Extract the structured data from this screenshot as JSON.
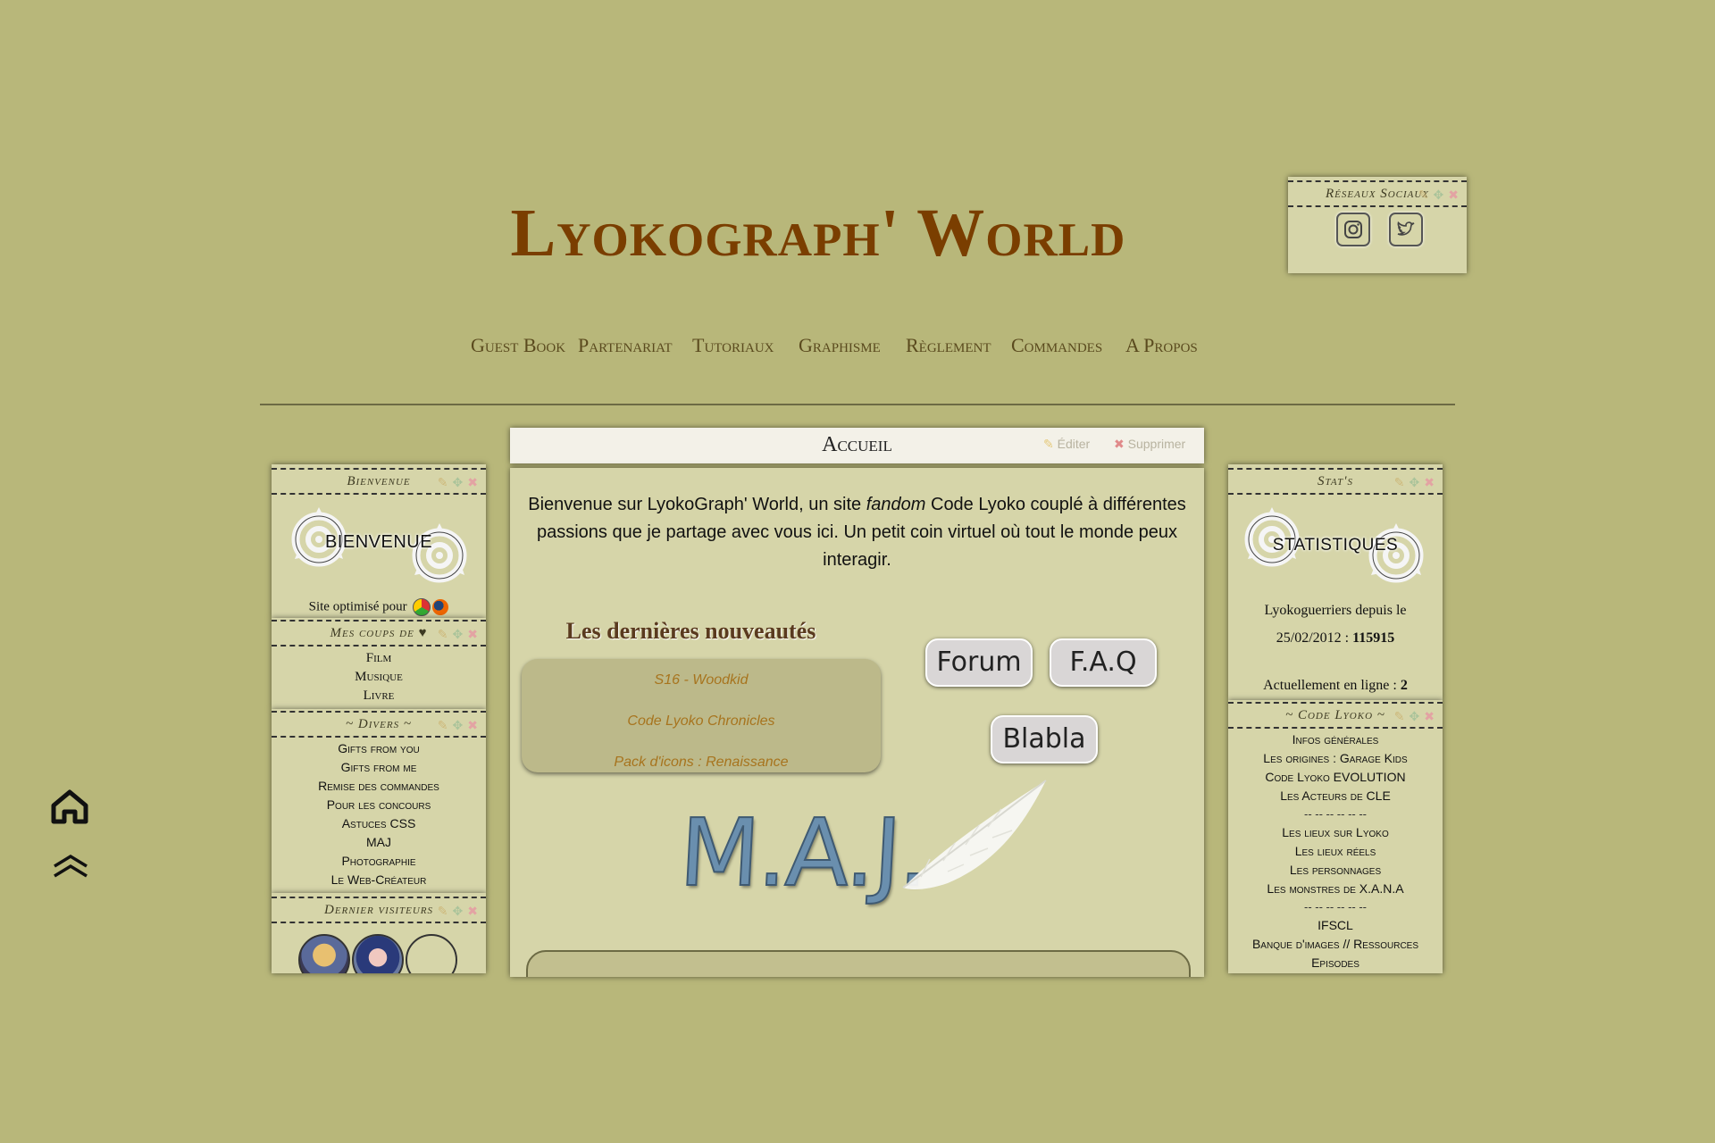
{
  "site": {
    "title": "Lyokograph' World"
  },
  "nav": [
    {
      "label": "Guest Book"
    },
    {
      "label": "Partenariat"
    },
    {
      "label": "Tutoriaux"
    },
    {
      "label": "Graphisme"
    },
    {
      "label": "Règlement"
    },
    {
      "label": "Commandes"
    },
    {
      "label": "A Propos"
    }
  ],
  "social": {
    "title": "Réseaux Sociaux",
    "icons": [
      "instagram-icon",
      "twitter-icon"
    ]
  },
  "left": {
    "bienvenue": {
      "title": "Bienvenue",
      "emblem_text": "BIENVENUE",
      "optimized_text": "Site optimisé pour"
    },
    "coups": {
      "title": "Mes coups de ♥",
      "items": [
        "Film",
        "Musique",
        "Livre"
      ]
    },
    "divers": {
      "title": "~ Divers ~",
      "items": [
        "Gifts from you",
        "Gifts from me",
        "Remise des commandes",
        "Pour les concours",
        "Astuces CSS",
        "MAJ",
        "Photographie",
        "Le Web-Créateur"
      ]
    },
    "visiteurs": {
      "title": "Dernier visiteurs"
    }
  },
  "center": {
    "title": "Accueil",
    "edit_label": "Éditer",
    "delete_label": "Supprimer",
    "welcome_pre": "Bienvenue sur LyokoGraph' World, un site ",
    "welcome_em": "fandom",
    "welcome_post": " Code Lyoko couplé à différentes passions que je partage avec vous ici. Un petit coin virtuel où tout le monde peux interagir.",
    "news_title": "Les dernières nouveautés",
    "news": [
      "S16 - Woodkid",
      "Code Lyoko Chronicles",
      "Pack d'icons : Renaissance"
    ],
    "buttons": {
      "forum": "Forum",
      "faq": "F.A.Q",
      "blabla": "Blabla"
    },
    "maj_text": "M.A.J."
  },
  "right": {
    "stats": {
      "title": "Stat's",
      "emblem_text": "STATISTIQUES",
      "since_label": "Lyokoguerriers depuis le",
      "since_date": "25/02/2012 : ",
      "count": "115915",
      "online_label": "Actuellement en ligne : ",
      "online_count": "2"
    },
    "codelyoko": {
      "title": "~ Code Lyoko ~",
      "group1": [
        "Infos générales",
        "Les origines : Garage Kids",
        "Code Lyoko EVOLUTION",
        "Les Acteurs de CLE"
      ],
      "divider": "-- -- -- -- -- --",
      "group2": [
        "Les lieux sur Lyoko",
        "Les lieux réels",
        "Les personnages",
        "Les monstres de X.A.N.A"
      ],
      "divider2": "-- -- -- -- -- --",
      "group3": [
        "IFSCL",
        "Banque d'images // Ressources",
        "Episodes"
      ]
    }
  },
  "colors": {
    "background": "#b8b77a",
    "panel": "#d6d5a9",
    "title": "#7a3e00",
    "news_link": "#a7741e"
  }
}
